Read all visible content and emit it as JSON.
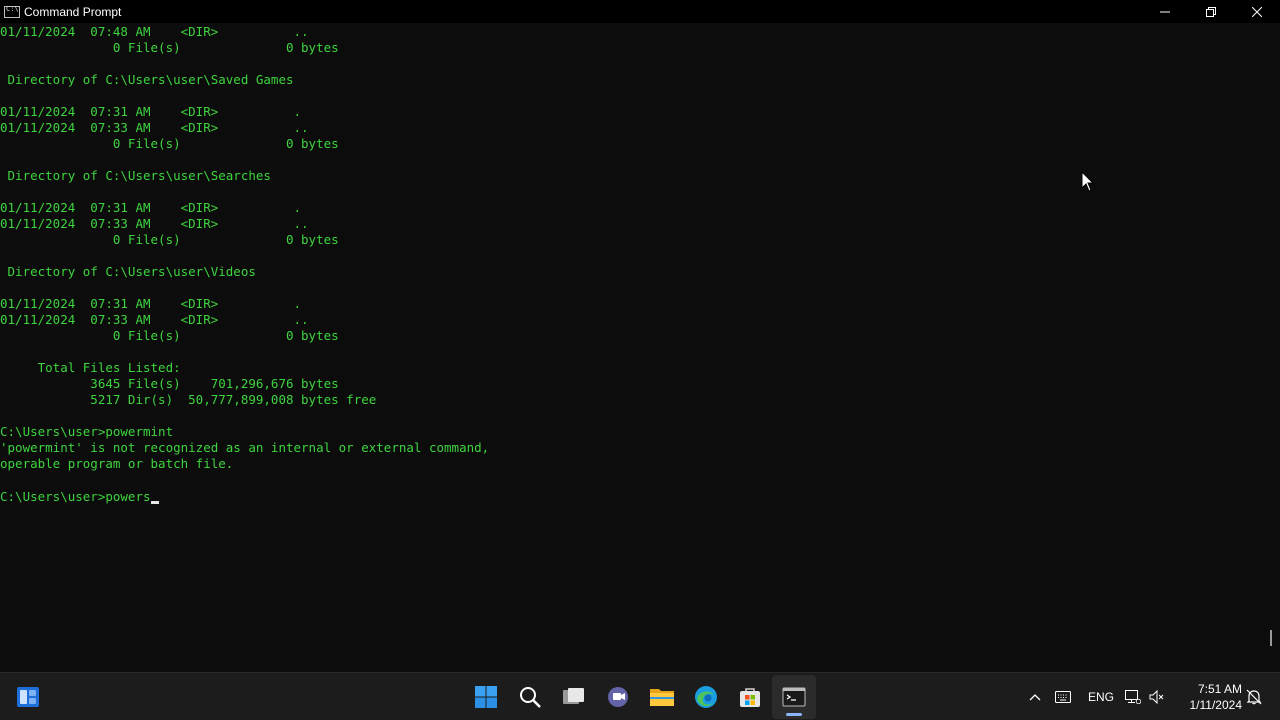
{
  "window": {
    "title": "Command Prompt",
    "controls": {
      "minimize": "—",
      "restore": "❐",
      "close": "✕"
    }
  },
  "console": {
    "lines": [
      "01/11/2024  07:48 AM    <DIR>          ..",
      "               0 File(s)              0 bytes",
      "",
      " Directory of C:\\Users\\user\\Saved Games",
      "",
      "01/11/2024  07:31 AM    <DIR>          .",
      "01/11/2024  07:33 AM    <DIR>          ..",
      "               0 File(s)              0 bytes",
      "",
      " Directory of C:\\Users\\user\\Searches",
      "",
      "01/11/2024  07:31 AM    <DIR>          .",
      "01/11/2024  07:33 AM    <DIR>          ..",
      "               0 File(s)              0 bytes",
      "",
      " Directory of C:\\Users\\user\\Videos",
      "",
      "01/11/2024  07:31 AM    <DIR>          .",
      "01/11/2024  07:33 AM    <DIR>          ..",
      "               0 File(s)              0 bytes",
      "",
      "     Total Files Listed:",
      "            3645 File(s)    701,296,676 bytes",
      "            5217 Dir(s)  50,777,899,008 bytes free",
      "",
      "C:\\Users\\user>powermint",
      "'powermint' is not recognized as an internal or external command,",
      "operable program or batch file.",
      ""
    ],
    "prompt": "C:\\Users\\user>",
    "current_input": "powers",
    "text_color": "#3ed43e",
    "background": "#0c0c0c"
  },
  "taskbar": {
    "items": [
      {
        "name": "widgets-icon"
      },
      {
        "name": "start-icon"
      },
      {
        "name": "search-icon"
      },
      {
        "name": "task-view-icon"
      },
      {
        "name": "teams-chat-icon"
      },
      {
        "name": "file-explorer-icon"
      },
      {
        "name": "edge-icon"
      },
      {
        "name": "store-icon"
      },
      {
        "name": "terminal-icon",
        "active": true
      }
    ],
    "tray": {
      "language": "ENG",
      "time": "7:51 AM",
      "date": "1/11/2024"
    },
    "accent": "#8ab4f8"
  }
}
